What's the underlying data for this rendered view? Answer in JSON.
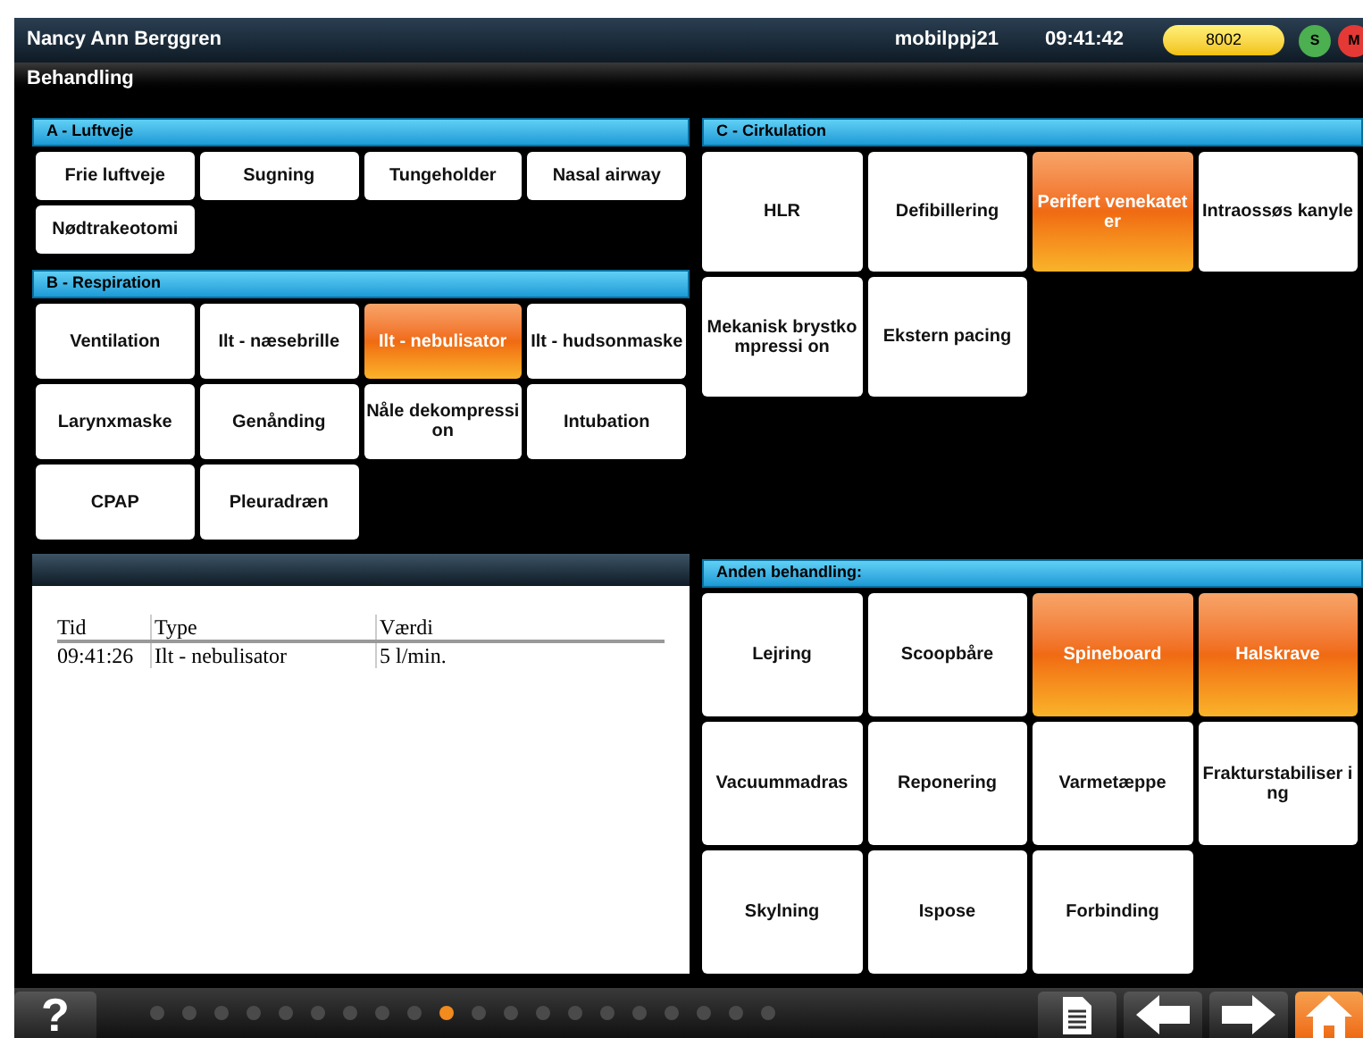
{
  "header": {
    "user": "Nancy Ann  Berggren",
    "device": "mobilppj21",
    "time": "09:41:42",
    "code": "8002",
    "indicators": [
      {
        "label": "S",
        "color": "#4caf50"
      },
      {
        "label": "M",
        "color": "#e53935"
      }
    ]
  },
  "title": "Behandling",
  "sections": [
    {
      "title": "A - Luftveje",
      "items": [
        {
          "label": "Frie luftveje",
          "selected": false
        },
        {
          "label": "Sugning",
          "selected": false
        },
        {
          "label": "Tungeholder",
          "selected": false
        },
        {
          "label": "Nasal airway",
          "selected": false
        },
        {
          "label": "Nødtrakeotomi",
          "selected": false
        }
      ]
    },
    {
      "title": "B - Respiration",
      "items": [
        {
          "label": "Ventilation",
          "selected": false
        },
        {
          "label": "Ilt - næsebrille",
          "selected": false
        },
        {
          "label": "Ilt - nebulisator",
          "selected": true
        },
        {
          "label": "Ilt - hudsonmaske",
          "selected": false
        },
        {
          "label": "Larynxmaske",
          "selected": false
        },
        {
          "label": "Genånding",
          "selected": false
        },
        {
          "label": "Nåle dekompression",
          "selected": false
        },
        {
          "label": "Intubation",
          "selected": false
        },
        {
          "label": "CPAP",
          "selected": false
        },
        {
          "label": "Pleuradræn",
          "selected": false
        }
      ]
    },
    {
      "title": "C - Cirkulation",
      "items": [
        {
          "label": "HLR",
          "selected": false
        },
        {
          "label": "Defibillering",
          "selected": false
        },
        {
          "label": "Perifert venekateter",
          "selected": true
        },
        {
          "label": "Intraossøs kanyle",
          "selected": false
        },
        {
          "label": "Mekanisk brystkompressi on",
          "selected": false
        },
        {
          "label": "Ekstern pacing",
          "selected": false
        }
      ]
    },
    {
      "title": "Anden behandling:",
      "items": [
        {
          "label": "Lejring",
          "selected": false
        },
        {
          "label": "Scoopbåre",
          "selected": false
        },
        {
          "label": "Spineboard",
          "selected": true
        },
        {
          "label": "Halskrave",
          "selected": true
        },
        {
          "label": "Vacuummadras",
          "selected": false
        },
        {
          "label": "Reponering",
          "selected": false
        },
        {
          "label": "Varmetæppe",
          "selected": false
        },
        {
          "label": "Frakturstabiliser ing",
          "selected": false
        },
        {
          "label": "Skylning",
          "selected": false
        },
        {
          "label": "Ispose",
          "selected": false
        },
        {
          "label": "Forbinding",
          "selected": false
        }
      ]
    }
  ],
  "log": {
    "columns": [
      "Tid",
      "Type",
      "Værdi"
    ],
    "rows": [
      [
        "09:41:26",
        "Ilt - nebulisator",
        "5 l/min."
      ]
    ]
  },
  "footer": {
    "help": "?",
    "pages": [
      {
        "selected": false
      },
      {
        "selected": false
      },
      {
        "selected": false
      },
      {
        "selected": false
      },
      {
        "selected": false
      },
      {
        "selected": false
      },
      {
        "selected": false
      },
      {
        "selected": false
      },
      {
        "selected": false
      },
      {
        "selected": true
      },
      {
        "selected": false
      },
      {
        "selected": false
      },
      {
        "selected": false
      },
      {
        "selected": false
      },
      {
        "selected": false
      },
      {
        "selected": false
      },
      {
        "selected": false
      },
      {
        "selected": false
      },
      {
        "selected": false
      },
      {
        "selected": false
      }
    ]
  }
}
